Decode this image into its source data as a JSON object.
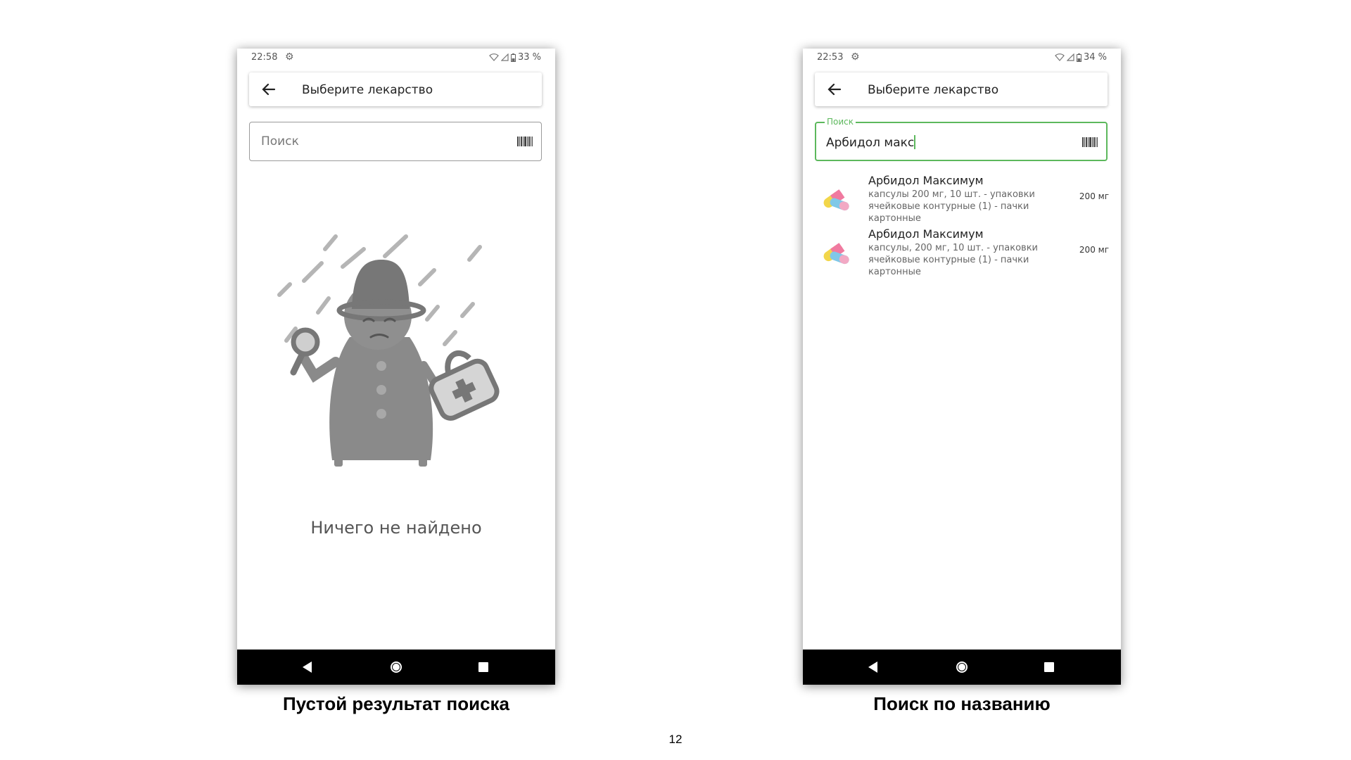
{
  "left_screen": {
    "status": {
      "time": "22:58",
      "battery": "33 %"
    },
    "appbar": {
      "title": "Выберите лекарство"
    },
    "search": {
      "placeholder": "Поиск"
    },
    "empty_message": "Ничего не найдено"
  },
  "right_screen": {
    "status": {
      "time": "22:53",
      "battery": "34 %"
    },
    "appbar": {
      "title": "Выберите лекарство"
    },
    "search": {
      "label": "Поиск",
      "value": "Арбидол макс"
    },
    "results": [
      {
        "name": "Арбидол Максимум",
        "description": "капсулы 200 мг, 10 шт. - упаковки ячейковые контурные (1) - пачки картонные",
        "dose": "200 мг"
      },
      {
        "name": "Арбидол Максимум",
        "description": "капсулы, 200 мг, 10 шт. - упаковки ячейковые контурные (1)  - пачки картонные",
        "dose": "200 мг"
      }
    ]
  },
  "captions": {
    "left": "Пустой результат поиска",
    "right": "Поиск по названию"
  },
  "page_number": "12",
  "colors": {
    "accent_green": "#5cb85c",
    "navbar": "#000000",
    "illustration_gray": "#8a8a8a"
  },
  "icons": [
    "back-arrow-icon",
    "barcode-icon",
    "wifi-icon",
    "signal-icon",
    "battery-icon",
    "gear-icon",
    "pill-icon",
    "nav-back-icon",
    "nav-home-icon",
    "nav-recent-icon"
  ]
}
